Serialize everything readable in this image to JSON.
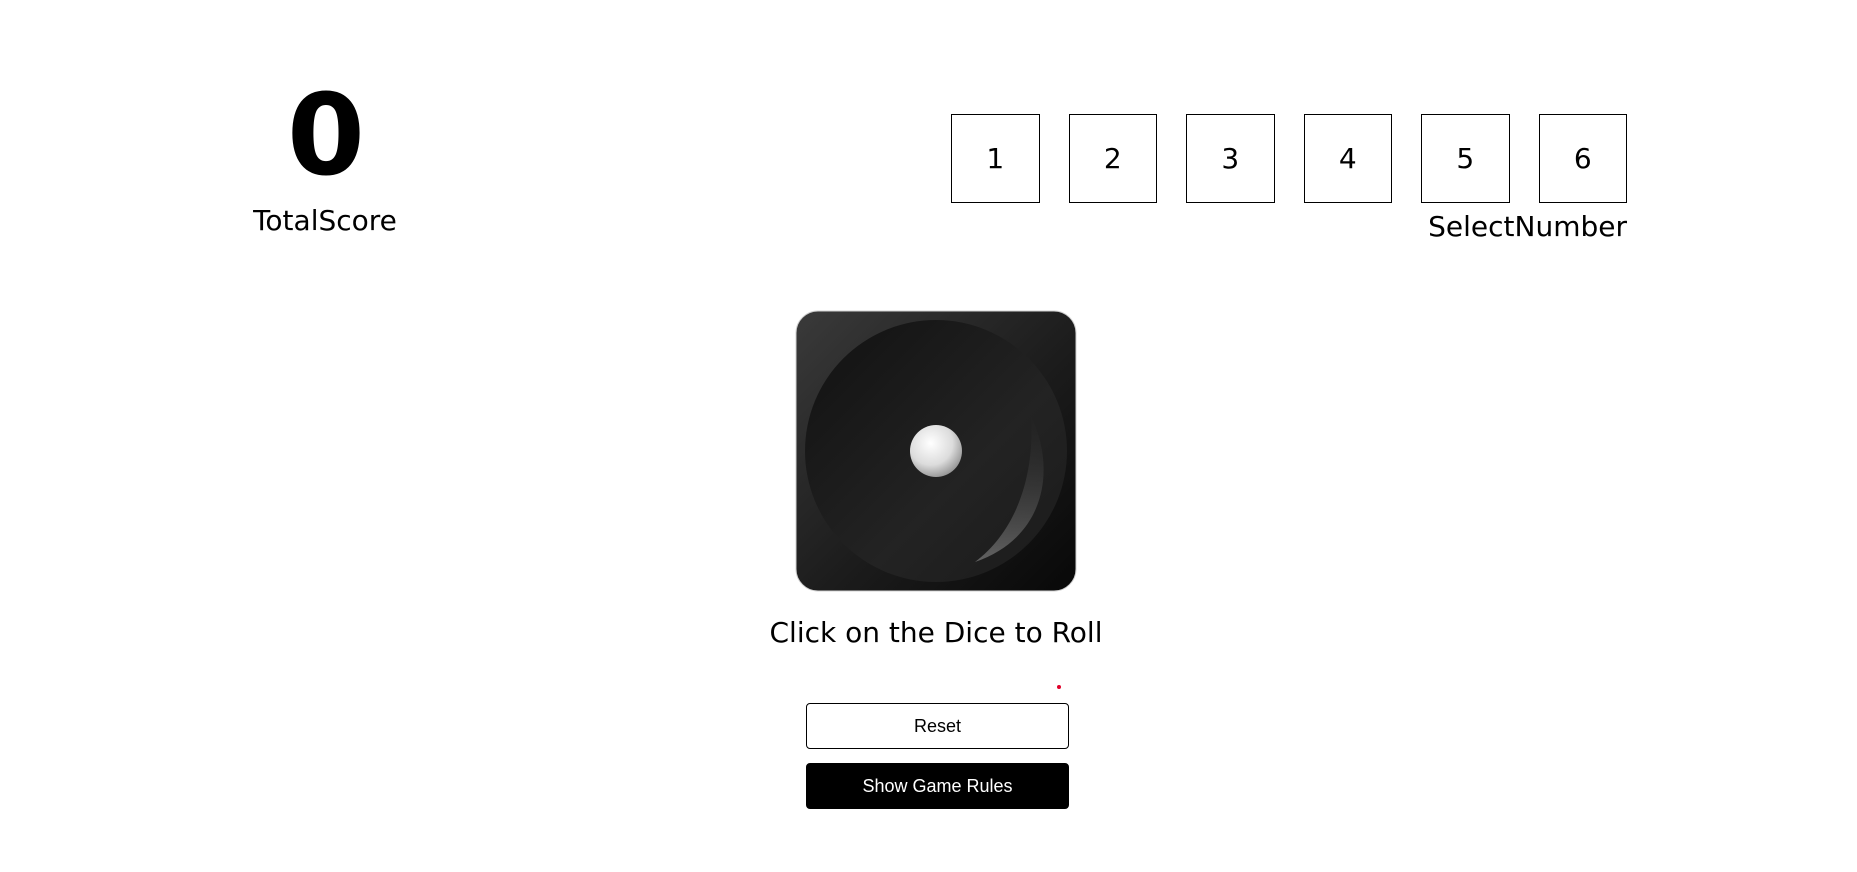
{
  "score": {
    "value": "0",
    "label": "TotalScore"
  },
  "number_selector": {
    "numbers": [
      "1",
      "2",
      "3",
      "4",
      "5",
      "6"
    ],
    "label": "SelectNumber"
  },
  "dice": {
    "face": 1,
    "hint": "Click on the Dice to Roll"
  },
  "buttons": {
    "reset_label": "Reset",
    "rules_label": "Show Game Rules"
  },
  "colors": {
    "primary": "#000000",
    "background": "#ffffff",
    "dot_accent": "#e0002a"
  }
}
